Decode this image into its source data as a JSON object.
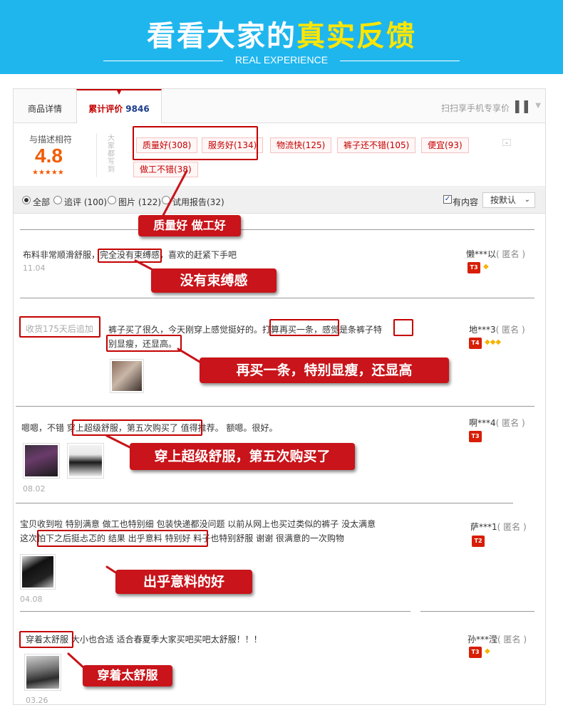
{
  "banner": {
    "title_main": "看看大家的",
    "title_highlight": "真实反馈",
    "subtitle": "REAL EXPERIENCE"
  },
  "tabs": {
    "detail": "商品详情",
    "reviews_label": "累计评价",
    "reviews_count": "9846",
    "scan_text": "扫扫享手机专享价"
  },
  "score": {
    "label": "与描述相符",
    "value": "4.8",
    "stars": "★★★★★",
    "impression": "大家都写到"
  },
  "tags": [
    "质量好(308)",
    "服务好(134)",
    "物流快(125)",
    "裤子还不错(105)",
    "便宜(93)",
    "做工不错(38)"
  ],
  "filters": {
    "all": "全部",
    "followup": "追评 (100)",
    "images": "图片 (122)",
    "trial": "试用报告(32)",
    "has_content": "有内容",
    "sort": "按默认",
    "sort_chevron": "⌄"
  },
  "colors": {
    "banner": "#1fb6ee",
    "highlight": "#ffe600",
    "accent": "#c40000",
    "score": "#f25c05"
  },
  "callouts": {
    "c0": "质量好  做工好",
    "c1": "没有束缚感",
    "c2": "再买一条，特别显瘦，还显高",
    "c3": "穿上超级舒服，第五次购买了",
    "c4": "出乎意料的好",
    "c5": "穿着太舒服"
  },
  "reviews": [
    {
      "line1": "布料非常顺滑舒服，完全没有束缚感，喜欢的赶紧下手吧",
      "date": "11.04",
      "user": "懒***以",
      "anon": "( 匿名 )",
      "level": "T3",
      "gems": "◆"
    },
    {
      "followup": "收货175天后追加",
      "line1": "裤子买了很久，今天刚穿上感觉挺好的。打算再买一条，感觉是条裤子特",
      "line2": "别显瘦，还显高。",
      "user": "地***3",
      "anon": "( 匿名 )",
      "level": "T4",
      "gems": "◆◆◆"
    },
    {
      "line1": "嗯嗯，不错  穿上超级舒服，第五次购买了  值得推荐。 额嗯。很好。",
      "date": "08.02",
      "user": "啊***4",
      "anon": "( 匿名 )",
      "level": "T3",
      "gems": ""
    },
    {
      "line1": "宝贝收到啦 特别满意 做工也特别细 包装快递都没问题 以前从网上也买过类似的裤子 没太满意",
      "line2": "这次怕下之后挺忐忑的 结果 出乎意料 特别好 料子也特别舒服 谢谢 很满意的一次购物",
      "date": "04.08",
      "user": "萨***1",
      "anon": "( 匿名 )",
      "level": "T2",
      "gems": ""
    },
    {
      "line1": "穿着太舒服 大小也合适 适合春夏季大家买吧买吧太舒服！！！",
      "date": "03.26",
      "user": "孙***滢",
      "anon": "( 匿名 )",
      "level": "T3",
      "gems": "◆"
    }
  ]
}
